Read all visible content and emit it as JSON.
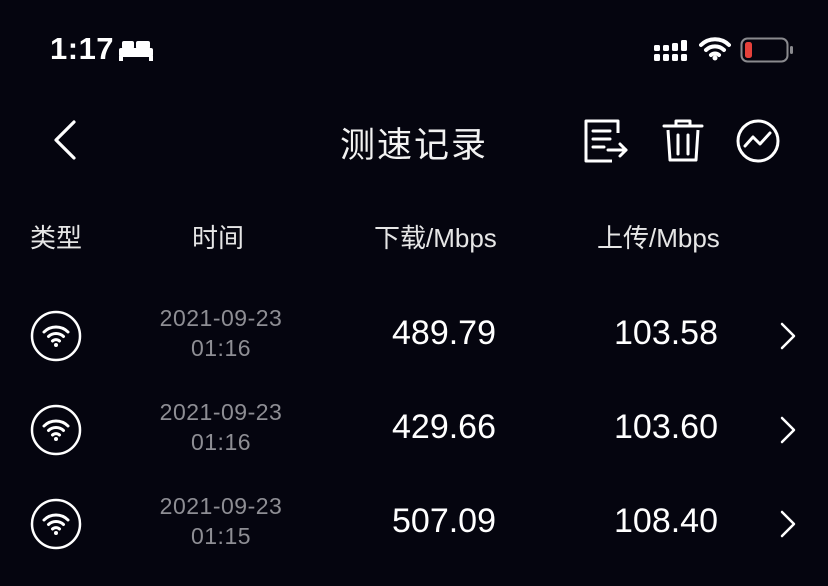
{
  "status_bar": {
    "time": "1:17",
    "icons": [
      "bed-icon",
      "cellular-signal-icon",
      "wifi-icon",
      "battery-low-icon"
    ],
    "battery_color": "#e5413b"
  },
  "nav": {
    "title": "测速记录",
    "icons": [
      "back-chevron-icon",
      "export-document-icon",
      "trash-icon",
      "trend-chart-icon"
    ]
  },
  "table": {
    "headers": {
      "type": "类型",
      "time": "时间",
      "download": "下载/Mbps",
      "upload": "上传/Mbps"
    },
    "rows": [
      {
        "type_icon": "wifi-icon",
        "date": "2021-09-23",
        "time": "01:16",
        "download": "489.79",
        "upload": "103.58"
      },
      {
        "type_icon": "wifi-icon",
        "date": "2021-09-23",
        "time": "01:16",
        "download": "429.66",
        "upload": "103.60"
      },
      {
        "type_icon": "wifi-icon",
        "date": "2021-09-23",
        "time": "01:15",
        "download": "507.09",
        "upload": "108.40"
      }
    ]
  },
  "colors": {
    "background": "#05050f",
    "text_primary": "#ffffff",
    "text_secondary": "#8e8e94"
  }
}
